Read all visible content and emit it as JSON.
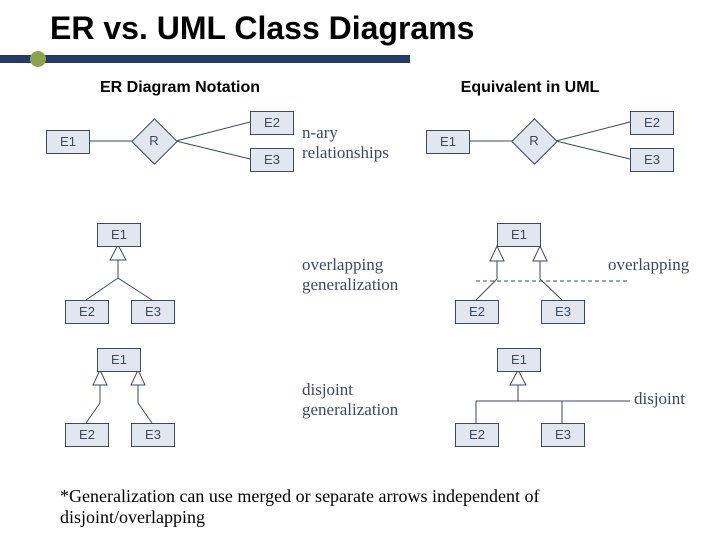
{
  "title": "ER vs. UML Class Diagrams",
  "col1_header": "ER Diagram Notation",
  "col2_header": "Equivalent in UML",
  "row1": {
    "er": {
      "e1": "E1",
      "r": "R",
      "e2": "E2",
      "e3": "E3"
    },
    "uml": {
      "e1": "E1",
      "r": "R",
      "e2": "E2",
      "e3": "E3"
    },
    "label": "n-ary\nrelationships"
  },
  "row2": {
    "er": {
      "e1": "E1",
      "e2": "E2",
      "e3": "E3"
    },
    "uml": {
      "e1": "E1",
      "e2": "E2",
      "e3": "E3"
    },
    "label_er": "overlapping\ngeneralization",
    "label_uml": "overlapping"
  },
  "row3": {
    "er": {
      "e1": "E1",
      "e2": "E2",
      "e3": "E3"
    },
    "uml": {
      "e1": "E1",
      "e2": "E2",
      "e3": "E3"
    },
    "label_er": "disjoint\ngeneralization",
    "label_uml": "disjoint"
  },
  "footnote": "*Generalization can use merged or separate arrows independent of disjoint/overlapping"
}
